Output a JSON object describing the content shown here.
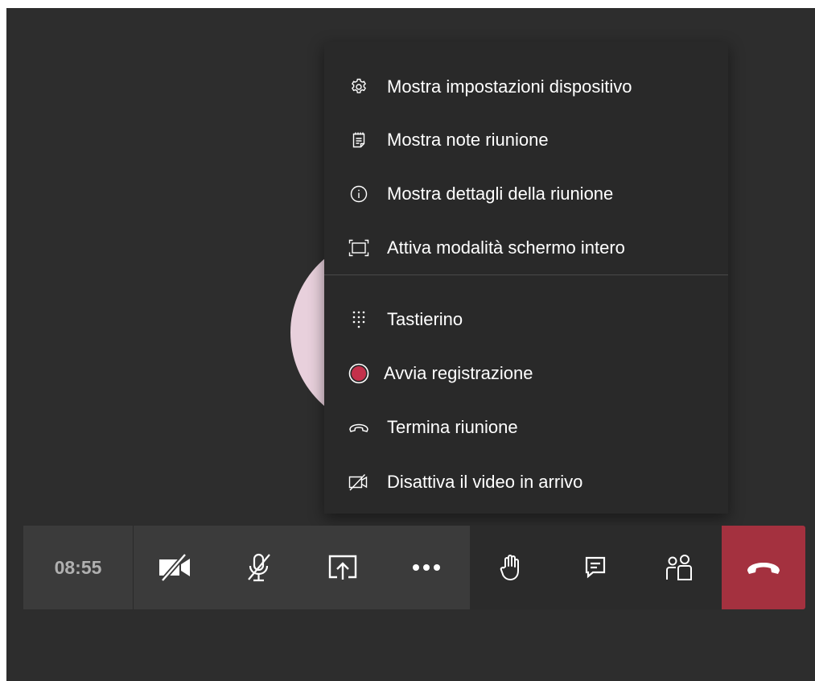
{
  "call": {
    "timer": "08:55"
  },
  "menu": {
    "items": [
      {
        "label": "Mostra impostazioni dispositivo",
        "icon": "gear-icon"
      },
      {
        "label": "Mostra note riunione",
        "icon": "notes-icon"
      },
      {
        "label": "Mostra dettagli della riunione",
        "icon": "info-icon"
      },
      {
        "label": "Attiva modalità schermo intero",
        "icon": "fullscreen-icon"
      },
      {
        "label": "Tastierino",
        "icon": "dialpad-icon"
      },
      {
        "label": "Avvia registrazione",
        "icon": "record-icon"
      },
      {
        "label": "Termina riunione",
        "icon": "end-meeting-icon"
      },
      {
        "label": "Disattiva il video in arrivo",
        "icon": "incoming-video-off-icon"
      }
    ]
  },
  "toolbar": {
    "buttons": [
      {
        "icon": "camera-off-icon"
      },
      {
        "icon": "mic-off-icon"
      },
      {
        "icon": "share-screen-icon"
      },
      {
        "icon": "more-options-icon"
      },
      {
        "icon": "raise-hand-icon"
      },
      {
        "icon": "chat-icon"
      },
      {
        "icon": "participants-icon"
      },
      {
        "icon": "hang-up-icon"
      }
    ]
  },
  "colors": {
    "stage_background": "#2d2d2d",
    "menu_background": "#292929",
    "toolbar_background": "#3b3b3b",
    "hang_up": "#a4313f",
    "record": "#c4314b",
    "avatar": "#e8d0dc"
  }
}
